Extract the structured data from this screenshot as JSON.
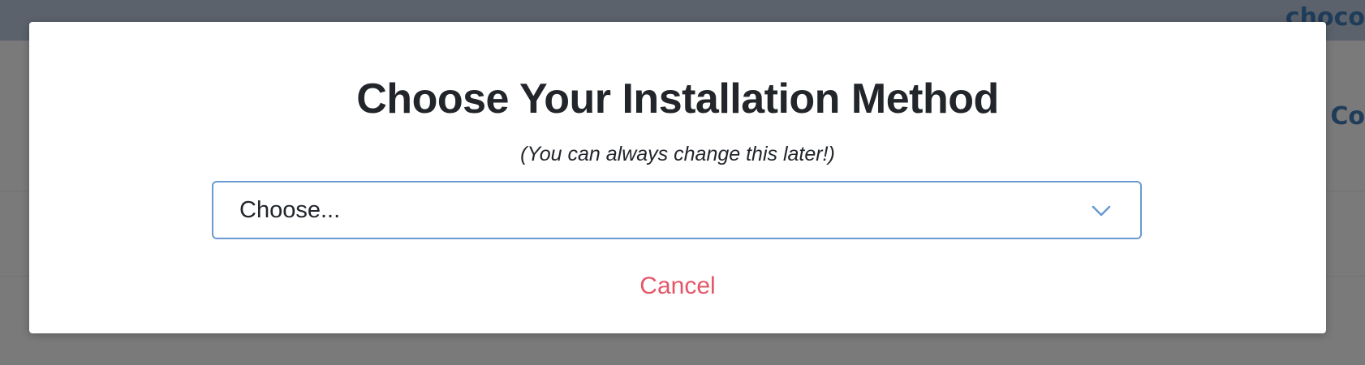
{
  "background": {
    "brand_text": "choco",
    "crumb_text": "Co"
  },
  "modal": {
    "title": "Choose Your Installation Method",
    "subtitle": "(You can always change this later!)",
    "select": {
      "value": "Choose...",
      "icon": "chevron-down-icon"
    },
    "cancel_label": "Cancel"
  },
  "colors": {
    "title": "#22262b",
    "select_border": "#6a9ad0",
    "chevron": "#6a9ad0",
    "cancel": "#e35768",
    "brand": "#3e78b2"
  }
}
